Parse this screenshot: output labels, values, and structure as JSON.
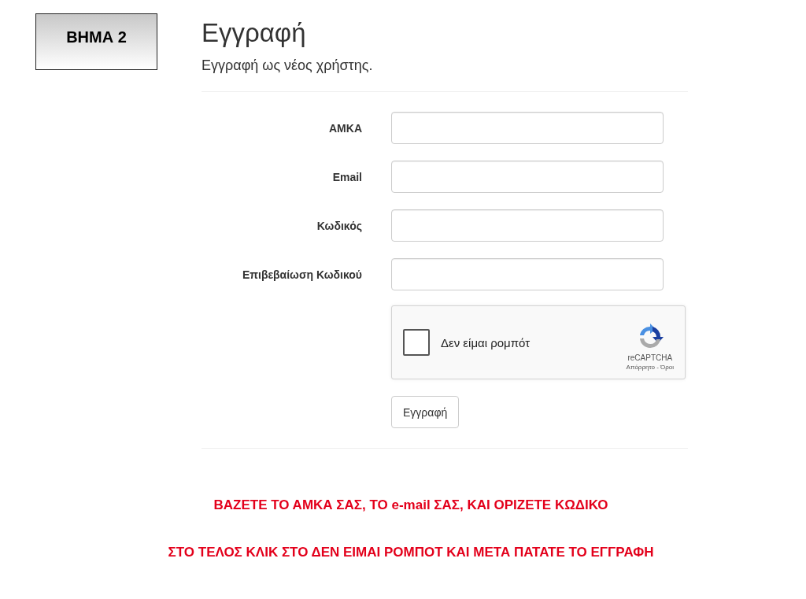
{
  "step_label": "ΒΗΜΑ 2",
  "title": "Εγγραφή",
  "subtitle": "Εγγραφή ως νέος χρήστης.",
  "fields": [
    {
      "label": "ΑΜΚΑ"
    },
    {
      "label": "Email"
    },
    {
      "label": "Κωδικός"
    },
    {
      "label": "Επιβεβαίωση Κωδικού"
    }
  ],
  "captcha": {
    "checked": false,
    "label": "Δεν είμαι ρομπότ",
    "brand": "reCAPTCHA",
    "links": "Απόρρητο - Όροι"
  },
  "submit_button": "Εγγραφή",
  "instructions": [
    "ΒΑΖΕΤΕ ΤΟ ΑΜΚΑ ΣΑΣ, ΤΟ e-mail ΣΑΣ, ΚΑΙ ΟΡΙΖΕΤΕ ΚΩΔΙΚΟ",
    "ΣΤΟ ΤΕΛΟΣ ΚΛΙΚ ΣΤΟ ΔΕΝ ΕΙΜΑΙ ΡΟΜΠΟΤ ΚΑΙ ΜΕΤΑ ΠΑΤΑΤΕ ΤΟ ΕΓΓΡΑΦΗ"
  ]
}
